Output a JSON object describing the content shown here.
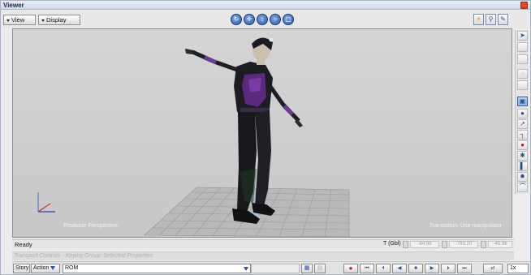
{
  "window": {
    "title": "Viewer",
    "close_icon": "close-icon"
  },
  "toolbar": {
    "view_label": "View",
    "display_label": "Display",
    "nav_icons": [
      "orbit-icon",
      "pan-icon",
      "dolly-icon",
      "zoom-icon",
      "frame-icon"
    ],
    "right_icons": [
      "lighting-icon",
      "zoom-window-icon",
      "edit-icon"
    ]
  },
  "viewport": {
    "camera_label": "Producer Perspective",
    "mode_label": "Translation: Use manipulator"
  },
  "tools": [
    "select-arrow-icon",
    "blank-tool-icon",
    "blank-tool-icon",
    "circle-tool-icon",
    "blank-tool-icon",
    "body-part-icon",
    "sphere-icon",
    "ik-chain-icon",
    "bone-icon",
    "record-dot-icon",
    "joint-icon",
    "floor-icon",
    "effector-icon",
    "curve-icon"
  ],
  "status": {
    "ready": "Ready",
    "transform_label": "T (Gbl)",
    "coord_x": "-64.99",
    "coord_y": "-769.20",
    "coord_z": "-45.06"
  },
  "transport_header": {
    "title": "Transport Controls",
    "separator": "-",
    "subtitle": "Keying Group: Selected Properties"
  },
  "transport": {
    "story_label": "Story",
    "action_label": "Action",
    "take_value": "ROM",
    "speed_value": "1x",
    "buttons": [
      "record-icon",
      "go-to-start-icon",
      "previous-key-icon",
      "step-back-icon",
      "stop-icon",
      "play-icon",
      "next-key-icon",
      "go-to-end-icon",
      "loop-icon"
    ]
  },
  "colors": {
    "viewport_bg": "#cecece",
    "accent": "#2d5ca8",
    "record": "#c61a1a",
    "costume_purple": "#5b2a7e"
  }
}
